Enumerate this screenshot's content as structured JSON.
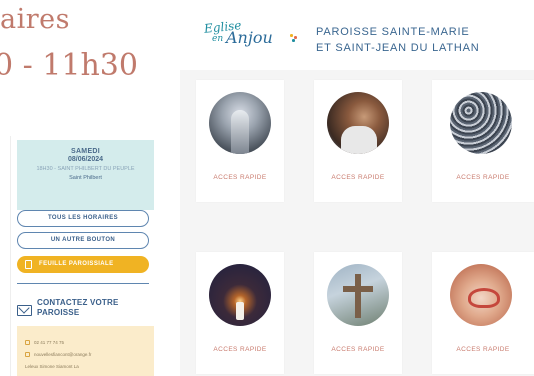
{
  "heading": {
    "line1": "aires",
    "line2": "0 - 11h30"
  },
  "mass_card": {
    "day": "SAMEDI",
    "date": "08/06/2024",
    "place": "18H30 - SAINT PHILBERT DU PEUPLE",
    "priest": "Saint Philbert"
  },
  "buttons": {
    "all_times": "TOUS LES HORAIRES",
    "another": "UN AUTRE BOUTON",
    "newsletter": "FEUILLE PAROISSIALE"
  },
  "contact": {
    "title": "CONTACTEZ VOTRE PAROISSE",
    "phone": "02 41 77 74 75",
    "email": "nouvellesfiancont@orange.fr",
    "address": "Leleux Simone Siamont La"
  },
  "logo": {
    "word1": "Eglise",
    "word2": "en",
    "word3": "Anjou"
  },
  "parish": {
    "line1": "PAROISSE SAINTE-MARIE",
    "line2": "ET SAINT-JEAN DU LATHAN"
  },
  "tiles": [
    {
      "label": "ACCES RAPIDE",
      "image": "church-interior"
    },
    {
      "label": "ACCES RAPIDE",
      "image": "man-portrait"
    },
    {
      "label": "ACCES RAPIDE",
      "image": "crowd"
    },
    {
      "label": "ACCES RAPIDE",
      "image": "candle"
    },
    {
      "label": "ACCES RAPIDE",
      "image": "cross"
    },
    {
      "label": "ACCES RAPIDE",
      "image": "hands-heart"
    }
  ],
  "colors": {
    "accent_text": "#c07a6c",
    "primary_blue": "#3a5f8a",
    "mass_card_bg": "#d4ecec",
    "button_yellow": "#f0b323",
    "contact_card_bg": "#fbeccb",
    "tile_label": "#c97b6e"
  }
}
